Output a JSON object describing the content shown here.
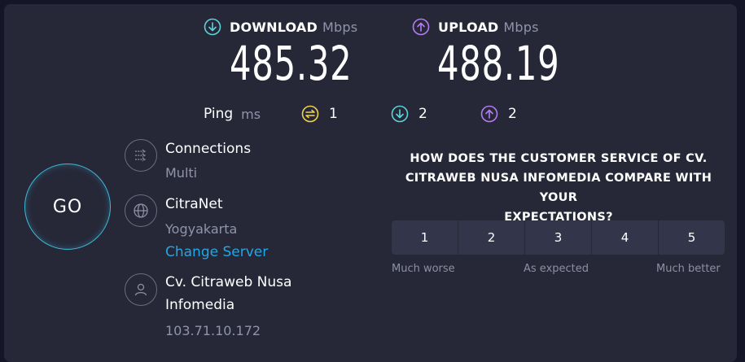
{
  "download": {
    "label": "DOWNLOAD",
    "unit": "Mbps",
    "value": "485.32",
    "icon": "download-arrow-icon",
    "color": "#5cd3d9"
  },
  "upload": {
    "label": "UPLOAD",
    "unit": "Mbps",
    "value": "488.19",
    "icon": "upload-arrow-icon",
    "color": "#b57cf2"
  },
  "ping": {
    "label": "Ping",
    "unit": "ms",
    "idle": "1",
    "download": "2",
    "upload": "2",
    "idle_color": "#f2d34a"
  },
  "go": {
    "label": "GO",
    "ring_color": "#3fb9d9"
  },
  "connections": {
    "title": "Connections",
    "value": "Multi",
    "icon": "connections-arrows-icon"
  },
  "server": {
    "title": "CitraNet",
    "location": "Yogyakarta",
    "change_label": "Change Server",
    "icon": "globe-icon",
    "link_color": "#1fa7e8"
  },
  "provider": {
    "title_line1": "Cv. Citraweb Nusa",
    "title_line2": "Infomedia",
    "ip": "103.71.10.172",
    "icon": "user-icon"
  },
  "survey": {
    "question_line1": "HOW DOES THE CUSTOMER SERVICE OF CV.",
    "question_line2": "CITRAWEB NUSA INFOMEDIA COMPARE WITH YOUR",
    "question_line3": "EXPECTATIONS?",
    "options": [
      "1",
      "2",
      "3",
      "4",
      "5"
    ],
    "caption_low": "Much worse",
    "caption_mid": "As expected",
    "caption_high": "Much better"
  }
}
